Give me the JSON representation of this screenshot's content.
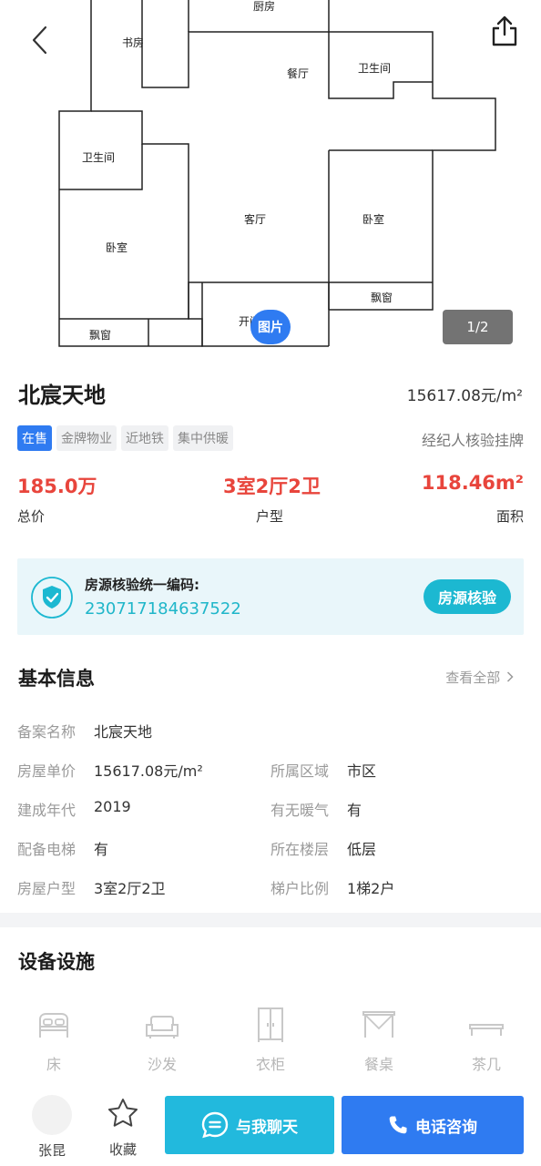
{
  "gallery": {
    "plan_rooms": [
      "厨房",
      "书房",
      "餐厅",
      "卫生间",
      "卫生间",
      "客厅",
      "卧室",
      "卧室",
      "飘窗",
      "飘窗",
      "开间"
    ],
    "pic_tag": "图片",
    "page_indicator": "1/2"
  },
  "listing": {
    "title": "北宸天地",
    "unit_price": "15617.08元/m²",
    "tags": [
      "在售",
      "金牌物业",
      "近地铁",
      "集中供暖"
    ],
    "agent_note": "经纪人核验挂牌",
    "total_price": "185.0万",
    "total_price_label": "总价",
    "layout": "3室2厅2卫",
    "layout_label": "户型",
    "area": "118.46m²",
    "area_label": "面积"
  },
  "verify": {
    "title": "房源核验统一编码:",
    "code": "230717184637522",
    "button": "房源核验"
  },
  "basic_info": {
    "title": "基本信息",
    "see_all": "查看全部",
    "rows": [
      {
        "label": "备案名称",
        "value": "北宸天地"
      },
      {
        "label": "房屋单价",
        "value": "15617.08元/m²"
      },
      {
        "label": "所属区域",
        "value": "市区"
      },
      {
        "label": "建成年代",
        "value": "2019"
      },
      {
        "label": "有无暖气",
        "value": "有"
      },
      {
        "label": "配备电梯",
        "value": "有"
      },
      {
        "label": "所在楼层",
        "value": "低层"
      },
      {
        "label": "房屋户型",
        "value": "3室2厅2卫"
      },
      {
        "label": "梯户比例",
        "value": "1梯2户"
      }
    ]
  },
  "facilities": {
    "title": "设备设施",
    "items": [
      {
        "label": "床",
        "icon": "bed-icon"
      },
      {
        "label": "沙发",
        "icon": "sofa-icon"
      },
      {
        "label": "衣柜",
        "icon": "wardrobe-icon"
      },
      {
        "label": "餐桌",
        "icon": "dining-table-icon"
      },
      {
        "label": "茶几",
        "icon": "coffee-table-icon"
      }
    ]
  },
  "bottom_bar": {
    "agent_name": "张昆",
    "favorite": "收藏",
    "chat": "与我聊天",
    "call": "电话咨询"
  },
  "colors": {
    "primary": "#2f7bf1",
    "price_red": "#e8453c",
    "teal": "#1cb8d1"
  }
}
